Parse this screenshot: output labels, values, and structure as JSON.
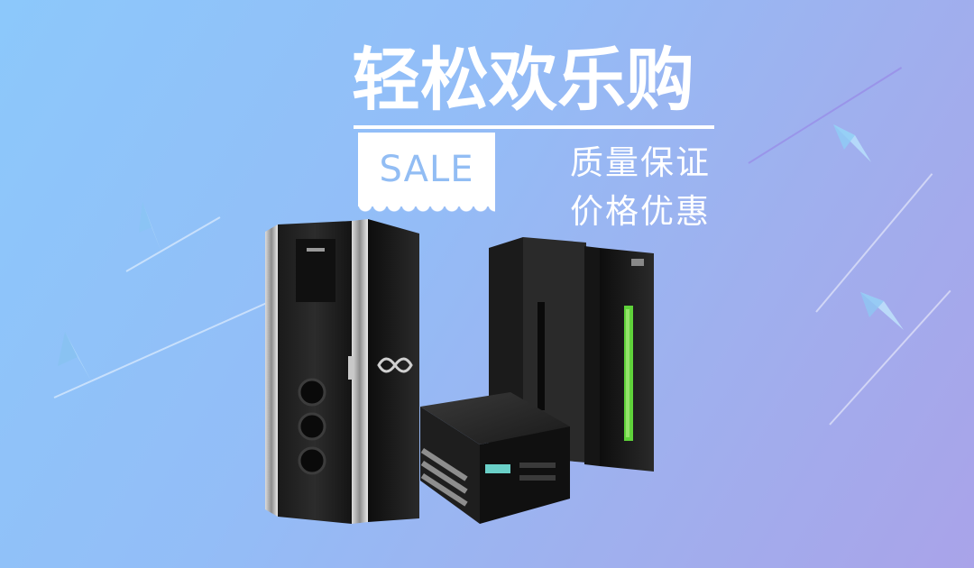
{
  "banner": {
    "headline": "轻松欢乐购",
    "sale_label": "SALE",
    "subtitle_1": "质量保证",
    "subtitle_2": "价格优惠"
  },
  "colors": {
    "background_start": "#8cc8fb",
    "background_end": "#a9a3e9",
    "sale_text": "#92bdf4",
    "text": "#ffffff",
    "server_green": "#5fd23a"
  },
  "icons": {
    "tower_server": "fujitsu-tower-server",
    "rack_server": "rack-server",
    "mainframe": "mainframe-cabinet"
  }
}
